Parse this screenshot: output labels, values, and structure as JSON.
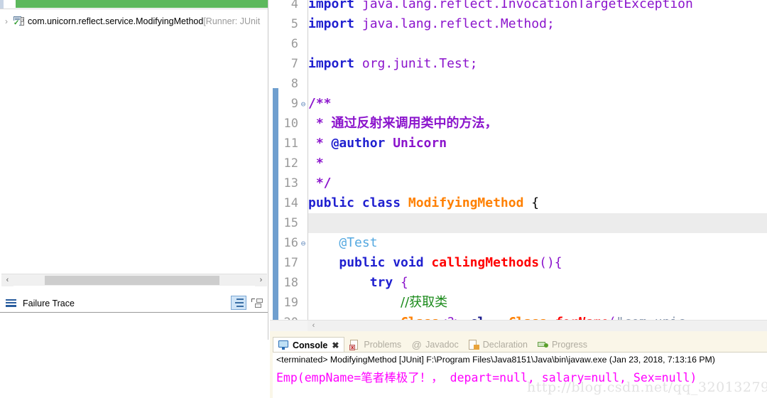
{
  "junit_view": {
    "progress_color": "#5cb85c",
    "tree": {
      "chevron": "›",
      "class_name": "com.unicorn.reflect.service.ModifyingMethod",
      "runner_suffix": " [Runner: JUnit"
    },
    "scrollbar": {
      "left_arrow": "‹",
      "right_arrow": "›"
    },
    "failure_trace": {
      "title": "Failure Trace",
      "filter_icon_name": "filter-stack-trace-icon",
      "layout_icon_name": "view-layout-icon"
    }
  },
  "editor": {
    "scroll_left_arrow": "‹",
    "lines": [
      {
        "no": "4",
        "fold": "",
        "highlight": false,
        "tokens": [
          {
            "t": "import ",
            "c": "kw"
          },
          {
            "t": "java.lang.reflect.InvocationTargetException",
            "c": "id"
          }
        ]
      },
      {
        "no": "5",
        "fold": "",
        "highlight": false,
        "tokens": [
          {
            "t": "import ",
            "c": "kw"
          },
          {
            "t": "java.lang.reflect.Method;",
            "c": "id"
          }
        ]
      },
      {
        "no": "6",
        "fold": "",
        "highlight": false,
        "tokens": []
      },
      {
        "no": "7",
        "fold": "",
        "highlight": false,
        "tokens": [
          {
            "t": "import ",
            "c": "kw"
          },
          {
            "t": "org.junit.Test;",
            "c": "id"
          }
        ]
      },
      {
        "no": "8",
        "fold": "",
        "highlight": false,
        "tokens": []
      },
      {
        "no": "9",
        "fold": "⊖",
        "highlight": false,
        "tokens": [
          {
            "t": "/**",
            "c": "jdoc"
          }
        ]
      },
      {
        "no": "10",
        "fold": "",
        "highlight": false,
        "tokens": [
          {
            "t": " * ",
            "c": "jdoc"
          },
          {
            "t": "通过反射来调用类中的方法，",
            "c": "jdoc cjk"
          }
        ]
      },
      {
        "no": "11",
        "fold": "",
        "highlight": false,
        "tokens": [
          {
            "t": " * ",
            "c": "jdoc"
          },
          {
            "t": "@author",
            "c": "jdoc-tag"
          },
          {
            "t": " Unicorn",
            "c": "jdoc"
          }
        ]
      },
      {
        "no": "12",
        "fold": "",
        "highlight": false,
        "tokens": [
          {
            "t": " *",
            "c": "jdoc"
          }
        ]
      },
      {
        "no": "13",
        "fold": "",
        "highlight": false,
        "tokens": [
          {
            "t": " */",
            "c": "jdoc"
          }
        ]
      },
      {
        "no": "14",
        "fold": "",
        "highlight": false,
        "tokens": [
          {
            "t": "public class ",
            "c": "kw"
          },
          {
            "t": "ModifyingMethod",
            "c": "type-orange"
          },
          {
            "t": " {",
            "c": "plain"
          }
        ]
      },
      {
        "no": "15",
        "fold": "",
        "highlight": true,
        "tokens": []
      },
      {
        "no": "16",
        "fold": "⊖",
        "highlight": false,
        "tokens": [
          {
            "t": "    ",
            "c": "plain"
          },
          {
            "t": "@Test",
            "c": "annot"
          }
        ]
      },
      {
        "no": "17",
        "fold": "",
        "highlight": false,
        "tokens": [
          {
            "t": "    ",
            "c": "plain"
          },
          {
            "t": "public void ",
            "c": "kw"
          },
          {
            "t": "callingMethods",
            "c": "method-red"
          },
          {
            "t": "(){",
            "c": "op"
          }
        ]
      },
      {
        "no": "18",
        "fold": "",
        "highlight": false,
        "tokens": [
          {
            "t": "        ",
            "c": "plain"
          },
          {
            "t": "try",
            "c": "kw-ctrl"
          },
          {
            "t": " {",
            "c": "op"
          }
        ]
      },
      {
        "no": "19",
        "fold": "",
        "highlight": false,
        "tokens": [
          {
            "t": "            ",
            "c": "plain"
          },
          {
            "t": "//获取类",
            "c": "cmt cjk"
          }
        ]
      },
      {
        "no": "20",
        "fold": "",
        "highlight": false,
        "tokens": [
          {
            "t": "            ",
            "c": "plain"
          },
          {
            "t": "Class",
            "c": "type-orange"
          },
          {
            "t": "<?>",
            "c": "op"
          },
          {
            "t": " ",
            "c": "plain"
          },
          {
            "t": "cl",
            "c": "var-blue"
          },
          {
            "t": " ",
            "c": "plain"
          },
          {
            "t": "=",
            "c": "op"
          },
          {
            "t": " ",
            "c": "plain"
          },
          {
            "t": "Class",
            "c": "type-orange"
          },
          {
            "t": ".",
            "c": "plain"
          },
          {
            "t": "forName",
            "c": "static-m"
          },
          {
            "t": "(",
            "c": "op"
          },
          {
            "t": "\"com.unic",
            "c": "str"
          }
        ]
      }
    ]
  },
  "console_panel": {
    "tabs": [
      {
        "label": "Console",
        "icon": "console-icon",
        "active": true,
        "closable": true,
        "close_glyph": "✖"
      },
      {
        "label": "Problems",
        "icon": "problems-icon",
        "active": false,
        "closable": false
      },
      {
        "label": "Javadoc",
        "icon": "javadoc-icon",
        "active": false,
        "closable": false
      },
      {
        "label": "Declaration",
        "icon": "declaration-icon",
        "active": false,
        "closable": false
      },
      {
        "label": "Progress",
        "icon": "progress-icon",
        "active": false,
        "closable": false
      }
    ],
    "terminated_line": "<terminated> ModifyingMethod [JUnit] F:\\Program Files\\Java8151\\Java\\bin\\javaw.exe (Jan 23, 2018, 7:13:16 PM)",
    "output_line": "Emp(empName=笔者棒极了！， depart=null, salary=null, Sex=null)",
    "output_color": "#ff00ff"
  },
  "watermark": {
    "text": "http://blog.csdn.net/qq_32013279"
  }
}
